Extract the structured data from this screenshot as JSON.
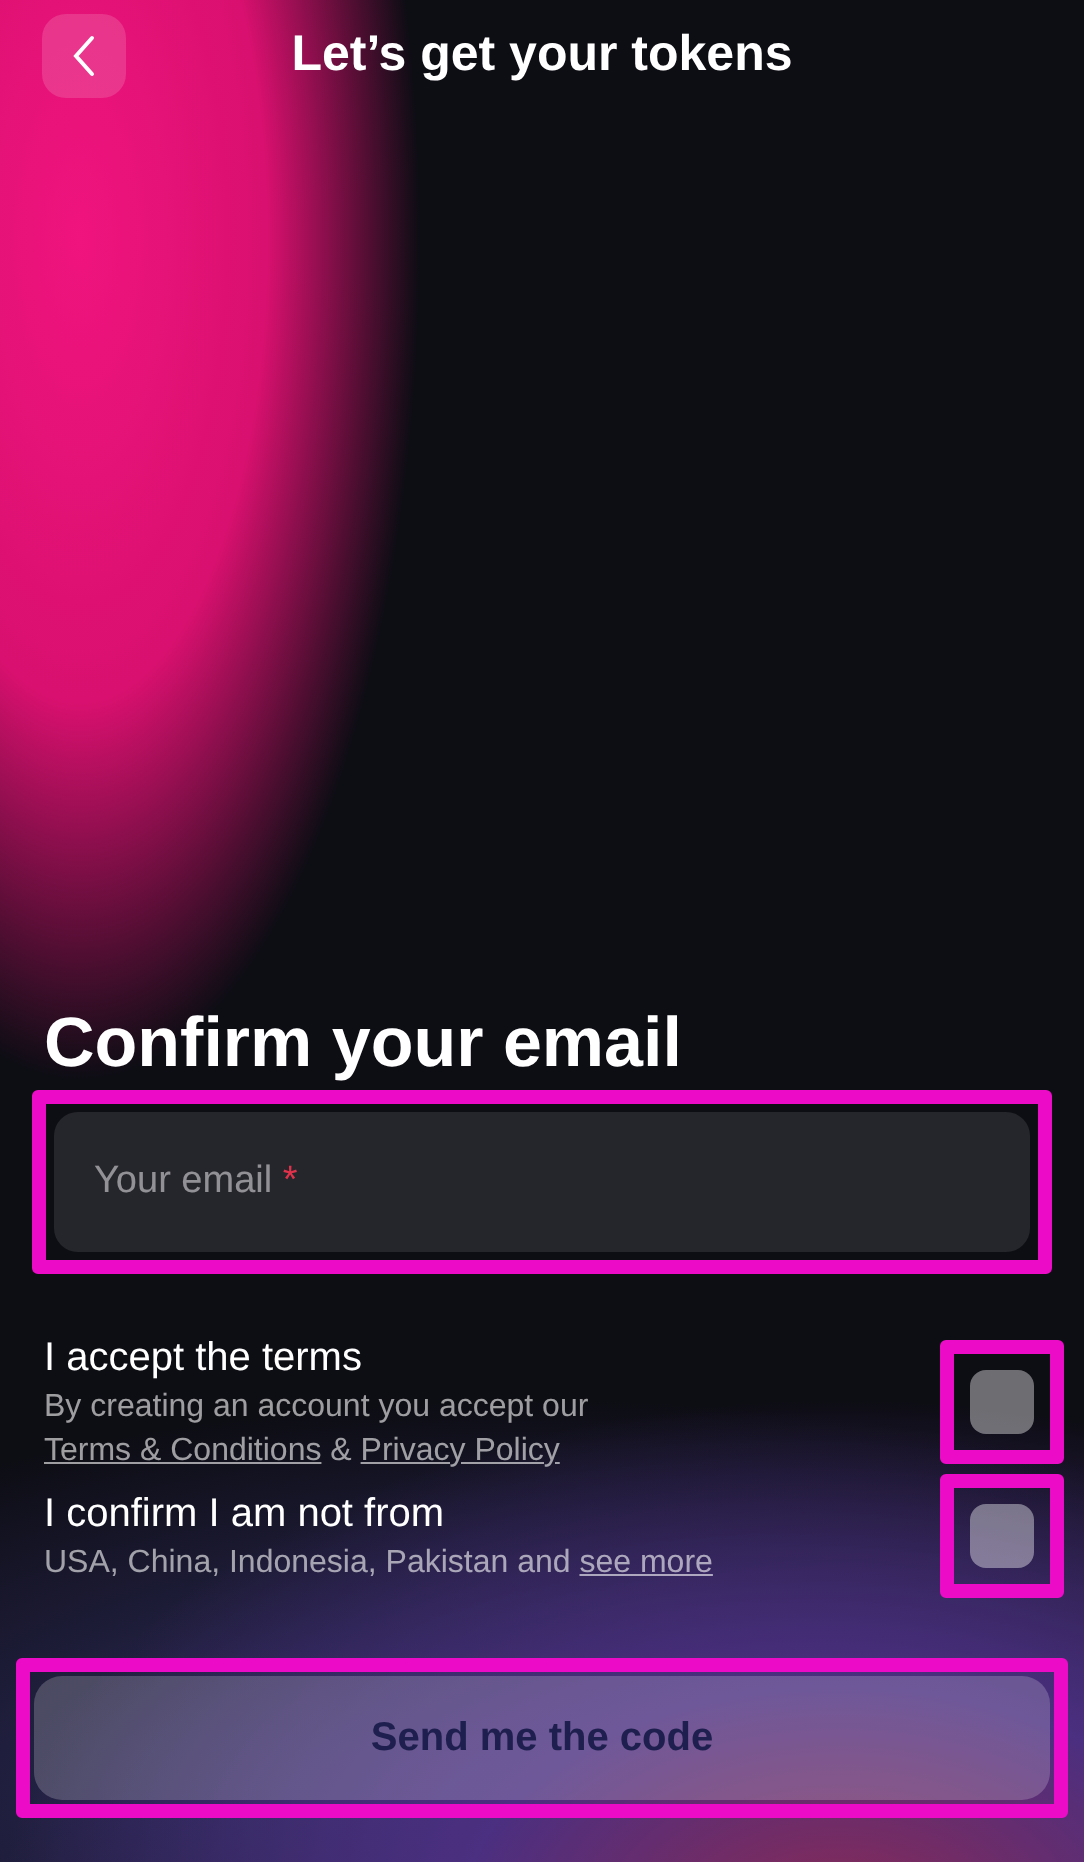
{
  "header": {
    "title": "Let’s get your tokens"
  },
  "form": {
    "heading": "Confirm your email",
    "email": {
      "placeholder": "Your email",
      "required_mark": "*",
      "highlighted": true
    },
    "consents": [
      {
        "label": "I accept the terms",
        "checked": false,
        "highlighted": true,
        "detail": [
          {
            "text": "By creating an account you accept our",
            "link": false
          },
          {
            "text": "Terms & Conditions",
            "link": true
          },
          {
            "text": "&",
            "link": false
          },
          {
            "text": "Privacy Policy",
            "link": true
          }
        ]
      },
      {
        "label": "I confirm I am not from",
        "checked": false,
        "highlighted": true,
        "detail": [
          {
            "text": "USA, China, Indonesia, Pakistan and",
            "link": false
          },
          {
            "text": "see more",
            "link": true
          }
        ]
      }
    ],
    "submit": {
      "label": "Send me the code",
      "disabled": true,
      "highlighted": true
    }
  }
}
